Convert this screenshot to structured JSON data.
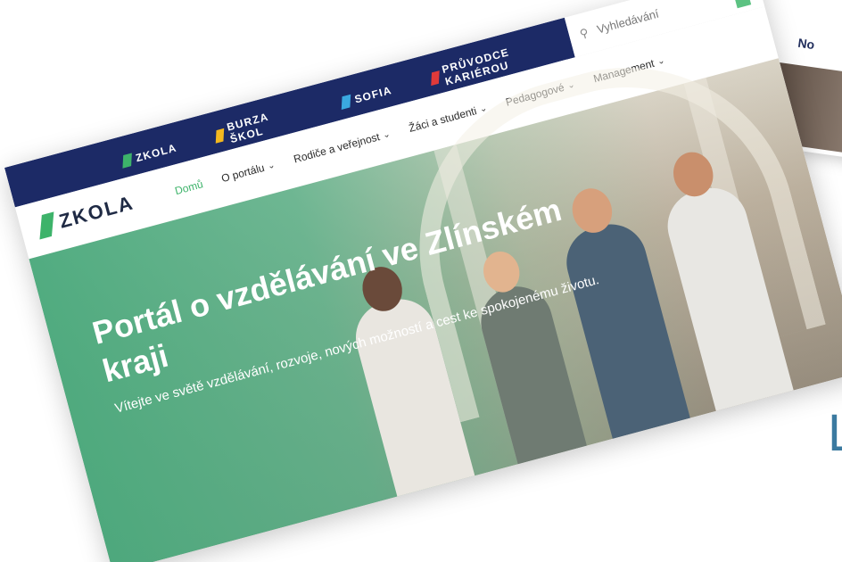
{
  "topbar": {
    "logos": [
      {
        "label": "ZKOLA",
        "color": "#3db36a"
      },
      {
        "label": "BURZA ŠKOL",
        "color": "#f3b81f"
      },
      {
        "label": "SOFIA",
        "color": "#3aa8e0"
      },
      {
        "label": "PRŮVODCE KARIÉROU",
        "color": "#e03a3a"
      }
    ]
  },
  "search": {
    "placeholder": "Vyhledávání"
  },
  "brand": {
    "name": "ZKOLA"
  },
  "menu": {
    "items": [
      {
        "label": "Domů"
      },
      {
        "label": "O portálu"
      },
      {
        "label": "Rodiče a veřejnost"
      },
      {
        "label": "Žáci a studenti"
      },
      {
        "label": "Pedagogové"
      },
      {
        "label": "Management"
      }
    ]
  },
  "hero": {
    "title_line1": "Portál o vzdělávání ve Zlínském",
    "title_line2": "kraji",
    "subtitle": "Vítejte ve světě vzdělávání, rozvoje, nových možností a cest ke spokojenému životu."
  },
  "second_shot": {
    "text": "No"
  },
  "edge_letter": "L"
}
